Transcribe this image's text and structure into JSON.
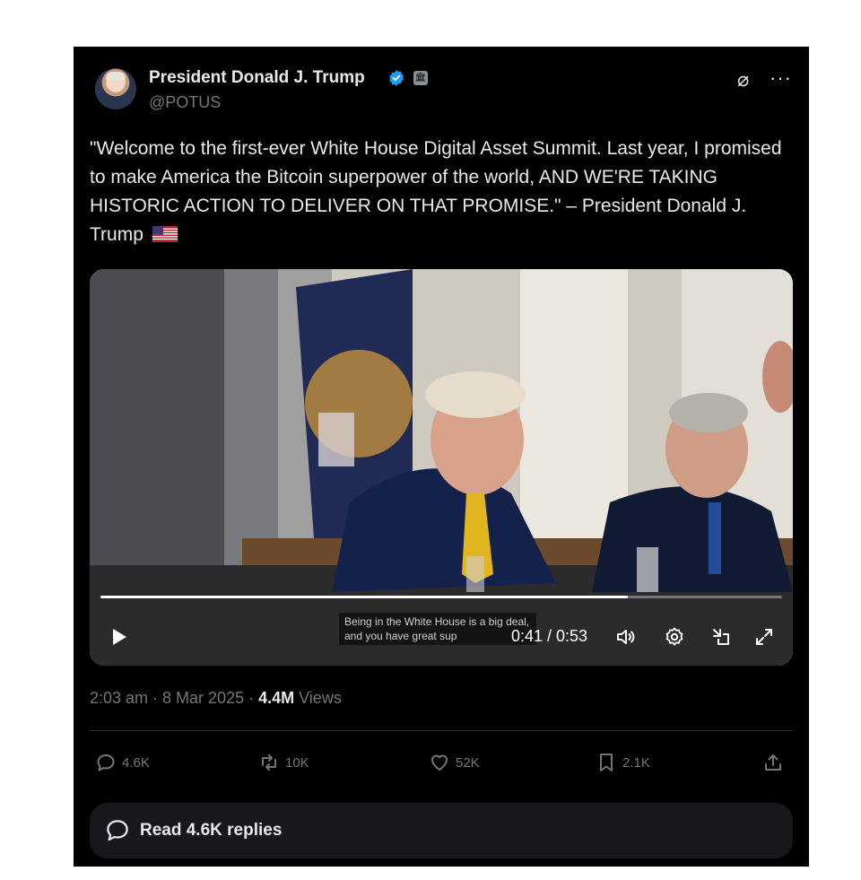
{
  "author": {
    "name": "President Donald J. Trump",
    "handle": "@POTUS",
    "verified_color": "#1d9bf0"
  },
  "tweet": {
    "text_main": "\"Welcome to the first-ever White House Digital Asset Summit. Last year, I promised to make America the Bitcoin superpower of the world, AND WE'RE TAKING HISTORIC ACTION TO DELIVER ON THAT PROMISE.\" – President Donald J. Trump",
    "emoji": "us-flag"
  },
  "video": {
    "caption": "Being in the White House is a big deal, and you have great sup",
    "time": "0:41 / 0:53",
    "progress": 0.774,
    "controls": [
      "play-icon",
      "volume-icon",
      "settings-icon",
      "minimize-icon",
      "fullscreen-icon"
    ]
  },
  "meta": {
    "timestamp": "2:03 am · 8 Mar 2025 · ",
    "views_count": "4.4M",
    "views_label": " Views"
  },
  "actions": {
    "replies": "4.6K",
    "reposts": "10K",
    "likes": "52K",
    "bookmarks": "2.1K"
  },
  "read_replies": "Read 4.6K replies",
  "colors": {
    "background": "#000000",
    "text": "#e7e9ea",
    "muted": "#71767b"
  }
}
